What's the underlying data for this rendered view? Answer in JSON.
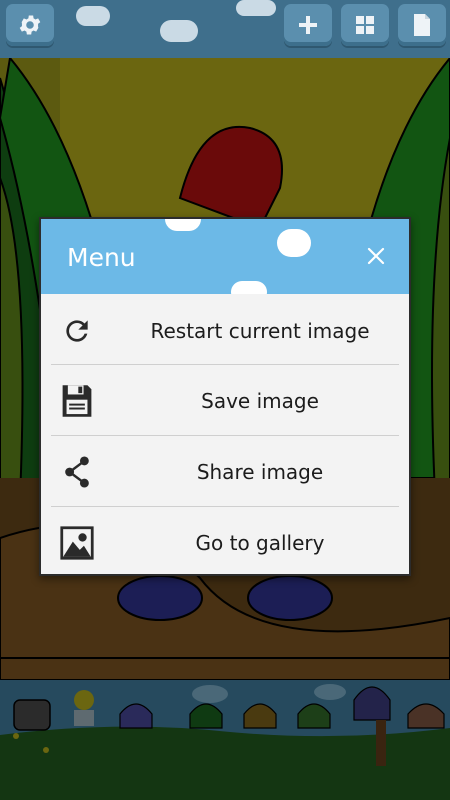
{
  "toolbar": {
    "settings": {
      "icon": "gear-icon"
    },
    "add": {
      "icon": "plus-icon"
    },
    "grid": {
      "icon": "grid-icon"
    },
    "document": {
      "icon": "document-icon"
    }
  },
  "dialog": {
    "title": "Menu",
    "close_icon": "close-icon",
    "items": [
      {
        "label": "Restart current image",
        "icon": "restart-icon"
      },
      {
        "label": "Save image",
        "icon": "save-icon"
      },
      {
        "label": "Share image",
        "icon": "share-icon"
      },
      {
        "label": "Go to gallery",
        "icon": "gallery-icon"
      }
    ]
  },
  "colors": {
    "toolbar_bg": "#3f6f8c",
    "toolbar_button": "#5b8fae",
    "dialog_header": "#6cb9e7",
    "dialog_body": "#f3f3f3"
  }
}
